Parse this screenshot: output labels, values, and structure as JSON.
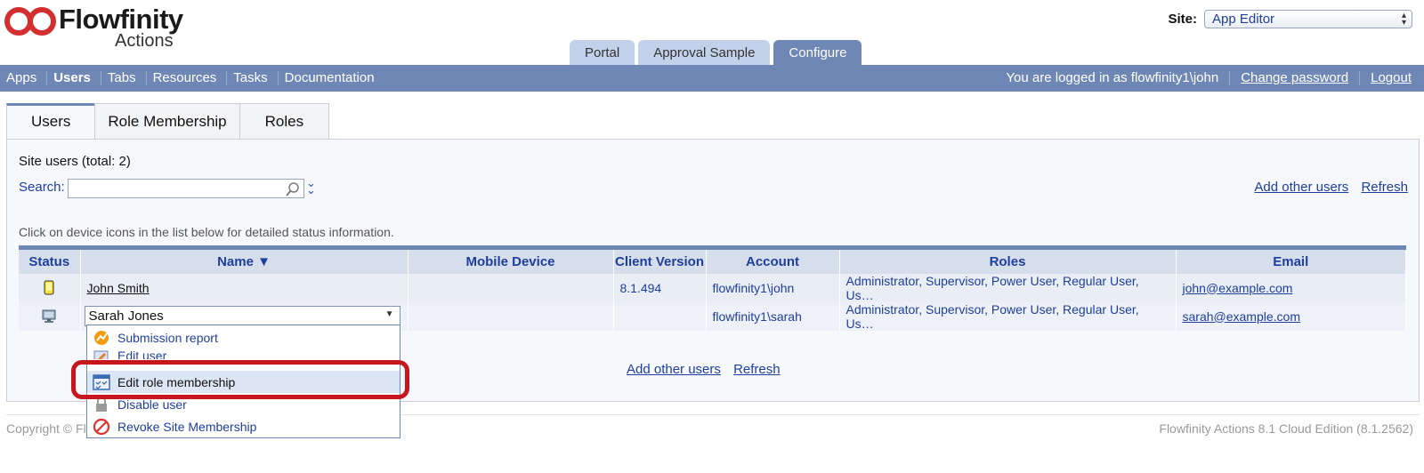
{
  "header": {
    "logo_title": "Flowfinity",
    "logo_subtitle": "Actions",
    "site_label": "Site:",
    "site_value": "App Editor"
  },
  "top_tabs": [
    {
      "label": "Portal",
      "active": false
    },
    {
      "label": "Approval Sample",
      "active": false
    },
    {
      "label": "Configure",
      "active": true
    }
  ],
  "nav": {
    "items": [
      "Apps",
      "Users",
      "Tabs",
      "Resources",
      "Tasks",
      "Documentation"
    ],
    "active": "Users",
    "logged_in_text": "You are logged in as flowfinity1\\john",
    "change_password": "Change password",
    "logout": "Logout"
  },
  "content_tabs": [
    {
      "label": "Users",
      "active": true
    },
    {
      "label": "Role Membership",
      "active": false
    },
    {
      "label": "Roles",
      "active": false
    }
  ],
  "users_panel": {
    "total_text": "Site users (total: 2)",
    "search_label": "Search:",
    "search_value": "",
    "add_other_users": "Add other users",
    "refresh": "Refresh",
    "hint": "Click on device icons in the list below for detailed status information."
  },
  "grid": {
    "columns": [
      "Status",
      "Name ▼",
      "Mobile Device",
      "Client Version",
      "Account",
      "Roles",
      "Email"
    ],
    "rows": [
      {
        "status_icon": "mobile-device-icon",
        "name": "John Smith",
        "mobile_device": "",
        "client_version": "8.1.494",
        "account": "flowfinity1\\john",
        "roles": "Administrator, Supervisor, Power User, Regular User, Us…",
        "email": "john@example.com"
      },
      {
        "status_icon": "desktop-device-icon",
        "name": "Sarah Jones",
        "mobile_device": "",
        "client_version": "",
        "account": "flowfinity1\\sarah",
        "roles": "Administrator, Supervisor, Power User, Regular User, Us…",
        "email": "sarah@example.com"
      }
    ]
  },
  "context_menu": {
    "items": [
      {
        "label": "Submission report",
        "icon": "report-icon"
      },
      {
        "label": "Edit user",
        "icon": "edit-icon"
      },
      {
        "label": "Edit role membership",
        "icon": "role-membership-icon",
        "highlighted": true
      },
      {
        "label": "Disable user",
        "icon": "lock-icon"
      },
      {
        "label": "Revoke Site Membership",
        "icon": "revoke-icon"
      }
    ]
  },
  "footer": {
    "copyright": "Copyright © Fl",
    "version": "Flowfinity Actions 8.1 Cloud Edition (8.1.2562)"
  },
  "colors": {
    "nav_bar": "#6e87b4",
    "tab_inactive": "#c2d1ea",
    "link": "#1f3f9e",
    "highlight_ring": "#c8161e"
  }
}
